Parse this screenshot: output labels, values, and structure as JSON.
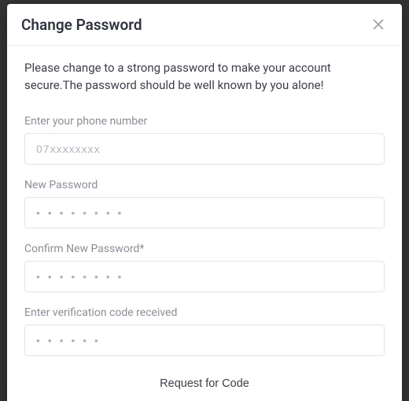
{
  "modal": {
    "title": "Change Password",
    "intro": "Please change to a strong password to make your account secure.The password should be well known by you alone!",
    "fields": {
      "phone": {
        "label": "Enter your phone number",
        "placeholder": "07xxxxxxxx"
      },
      "new_password": {
        "label": "New Password",
        "placeholder": "• • • • • • • •"
      },
      "confirm_password": {
        "label": "Confirm New Password*",
        "placeholder": "• • • • • • • •"
      },
      "verification": {
        "label": "Enter verification code received",
        "placeholder": "• • • • • •"
      }
    },
    "request_code_label": "Request for Code"
  }
}
